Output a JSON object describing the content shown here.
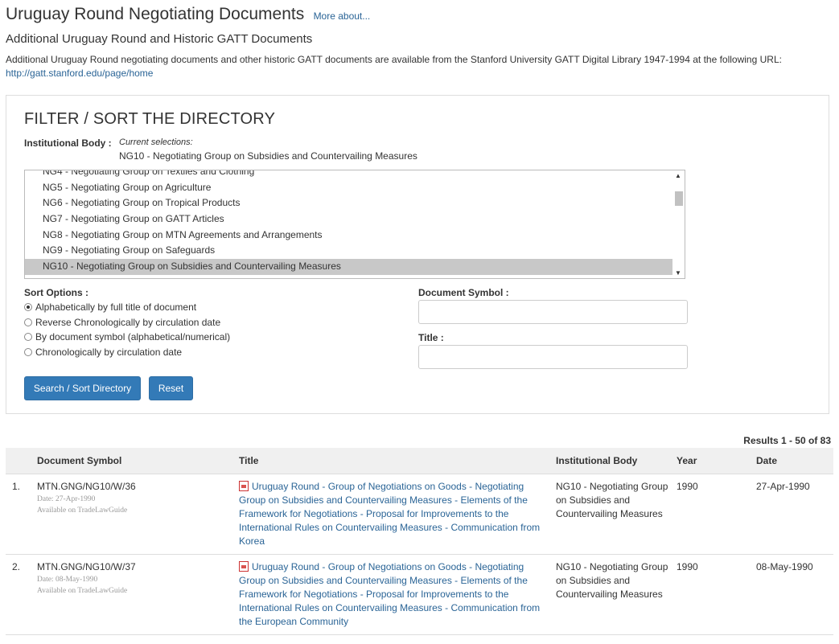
{
  "header": {
    "title": "Uruguay Round Negotiating Documents",
    "more_link": "More about...",
    "subtitle": "Additional Uruguay Round and Historic GATT Documents",
    "intro_text": "Additional Uruguay Round negotiating documents and other historic GATT documents are available from the Stanford University GATT Digital Library 1947-1994 at the following URL:",
    "intro_url": "http://gatt.stanford.edu/page/home"
  },
  "filter": {
    "title": "FILTER / SORT THE DIRECTORY",
    "institutional_body_label": "Institutional Body :",
    "current_selections_label": "Current selections:",
    "current_selection_value": "NG10 - Negotiating Group on Subsidies and Countervailing Measures",
    "options": [
      "NG4 - Negotiating Group on Textiles and Clothing",
      "NG5 - Negotiating Group on Agriculture",
      "NG6 - Negotiating Group on Tropical Products",
      "NG7 - Negotiating Group on GATT Articles",
      "NG8 - Negotiating Group on MTN Agreements and Arrangements",
      "NG9 - Negotiating Group on Safeguards",
      "NG10 - Negotiating Group on Subsidies and Countervailing Measures"
    ],
    "sort_label": "Sort Options :",
    "sort_options": [
      "Alphabetically by full title of document",
      "Reverse Chronologically by circulation date",
      "By document symbol (alphabetical/numerical)",
      "Chronologically by circulation date"
    ],
    "doc_symbol_label": "Document Symbol :",
    "doc_symbol_value": "",
    "title_label": "Title :",
    "title_value": "",
    "search_button": "Search / Sort Directory",
    "reset_button": "Reset"
  },
  "results": {
    "count_text": "Results 1 - 50 of 83",
    "columns": [
      "Document Symbol",
      "Title",
      "Institutional Body",
      "Year",
      "Date"
    ],
    "rows": [
      {
        "num": "1.",
        "symbol": "MTN.GNG/NG10/W/36",
        "date_small": "Date: 27-Apr-1990",
        "avail": "Available on TradeLawGuide",
        "title": "Uruguay Round - Group of Negotiations on Goods - Negotiating Group on Subsidies and Countervailing Measures - Elements of the Framework for Negotiations - Proposal for Improvements to the International Rules on Countervailing Measures - Communication from Korea",
        "body": "NG10 - Negotiating Group on Subsidies and Countervailing Measures",
        "year": "1990",
        "date": "27-Apr-1990"
      },
      {
        "num": "2.",
        "symbol": "MTN.GNG/NG10/W/37",
        "date_small": "Date: 08-May-1990",
        "avail": "Available on TradeLawGuide",
        "title": "Uruguay Round - Group of Negotiations on Goods - Negotiating Group on Subsidies and Countervailing Measures - Elements of the Framework for Negotiations - Proposal for Improvements to the International Rules on Countervailing Measures - Communication from the European Community",
        "body": "NG10 - Negotiating Group on Subsidies and Countervailing Measures",
        "year": "1990",
        "date": "08-May-1990"
      }
    ]
  },
  "colors": {
    "link": "#2a6496",
    "button": "#337ab7",
    "selected_option": "#c8c8c8",
    "table_header": "#f0f0f0"
  }
}
